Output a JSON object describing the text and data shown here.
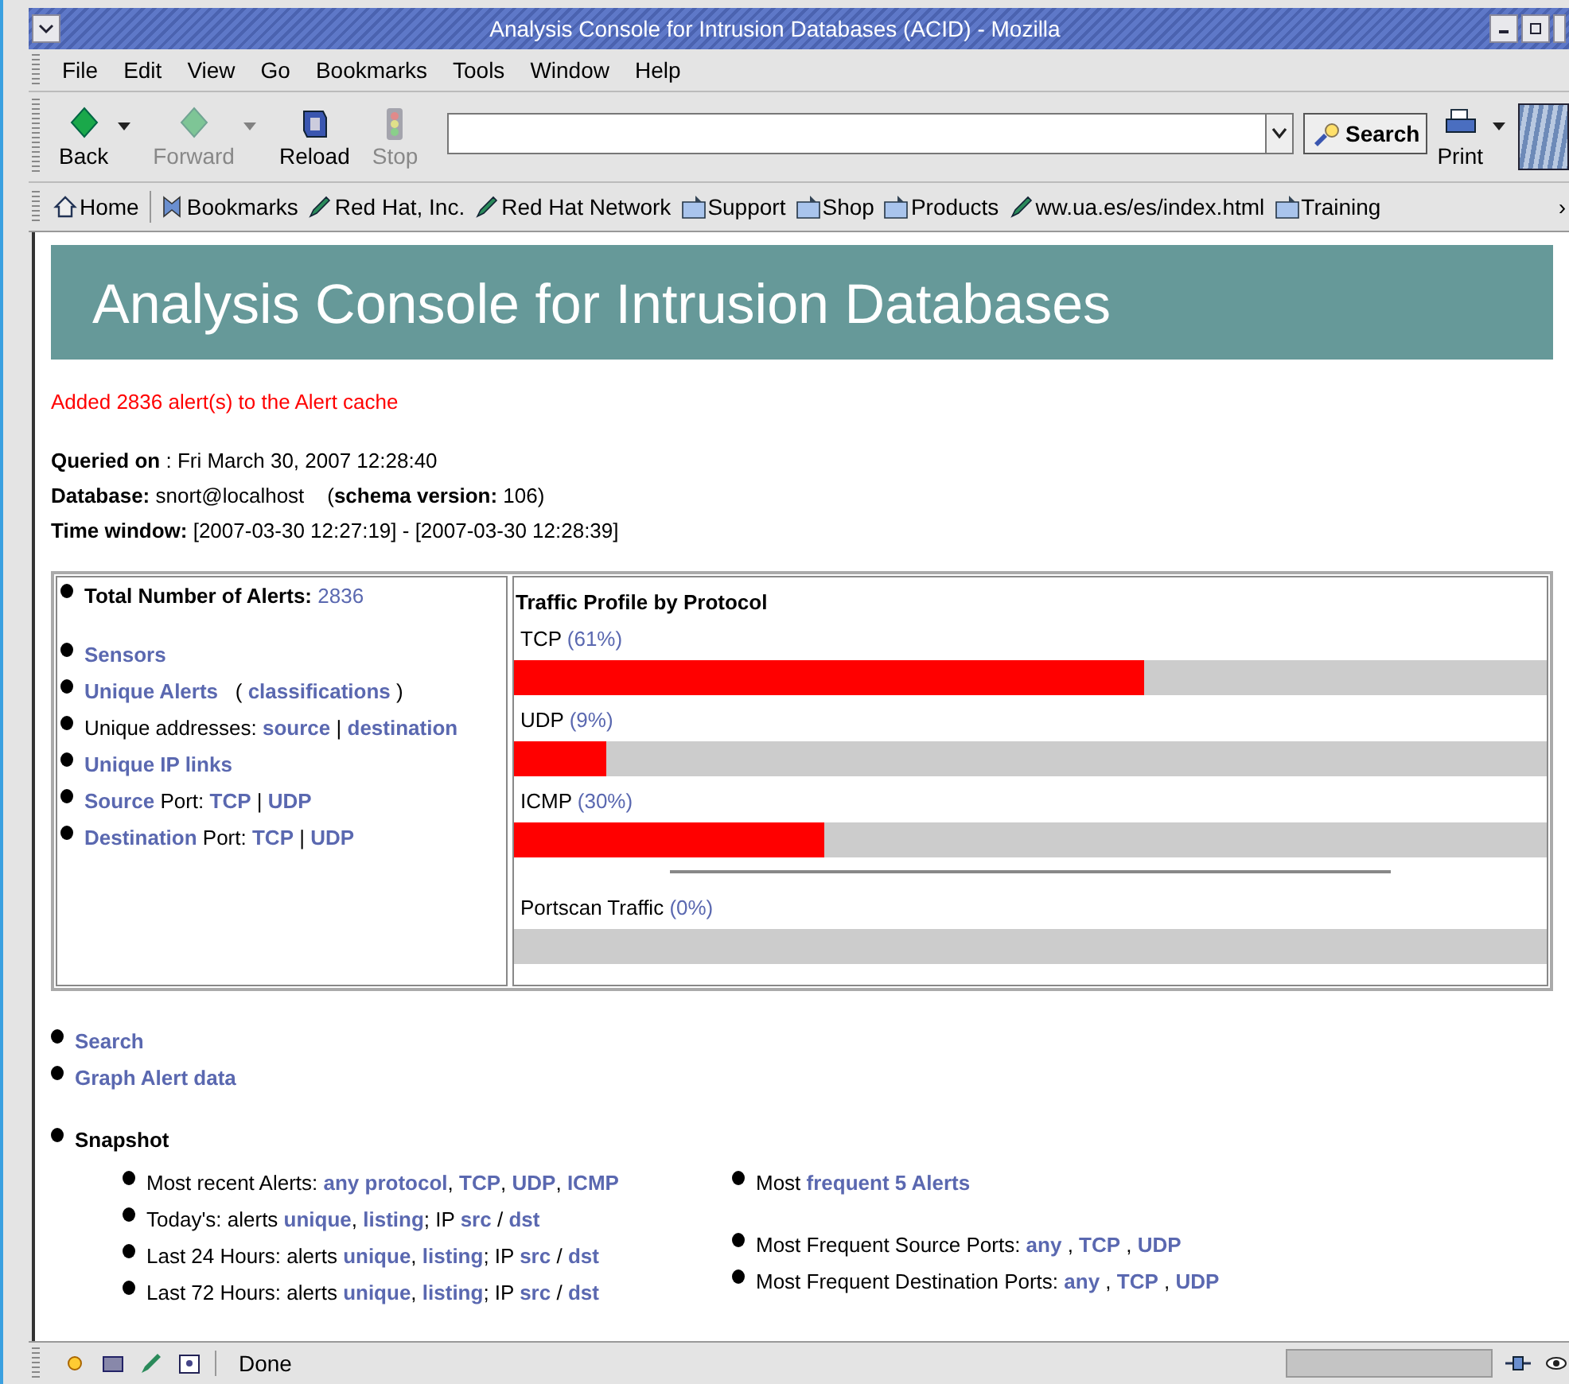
{
  "window": {
    "title": "Analysis Console for Intrusion Databases (ACID) - Mozilla"
  },
  "menu": [
    "File",
    "Edit",
    "View",
    "Go",
    "Bookmarks",
    "Tools",
    "Window",
    "Help"
  ],
  "toolbar": {
    "buttons": [
      {
        "label": "Back",
        "kind": "back",
        "disabled": false,
        "dropdown": true
      },
      {
        "label": "Forward",
        "kind": "forward",
        "disabled": true,
        "dropdown": true
      },
      {
        "label": "Reload",
        "kind": "reload",
        "disabled": false,
        "dropdown": false
      },
      {
        "label": "Stop",
        "kind": "stop",
        "disabled": true,
        "dropdown": false
      }
    ],
    "search_button": "Search",
    "print_button": "Print"
  },
  "bookmarks": [
    {
      "label": "Home",
      "kind": "home"
    },
    {
      "label": "Bookmarks",
      "kind": "bookmarks"
    },
    {
      "label": "Red Hat, Inc.",
      "kind": "link"
    },
    {
      "label": "Red Hat Network",
      "kind": "link"
    },
    {
      "label": "Support",
      "kind": "folder"
    },
    {
      "label": "Shop",
      "kind": "folder"
    },
    {
      "label": "Products",
      "kind": "folder"
    },
    {
      "label": "ww.ua.es/es/index.html",
      "kind": "link"
    },
    {
      "label": "Training",
      "kind": "folder"
    }
  ],
  "bookmarks_overflow": "›",
  "page": {
    "banner": "Analysis Console for Intrusion Databases",
    "notice": "Added 2836 alert(s) to the Alert cache",
    "query_info": [
      [
        {
          "t": "Queried on",
          "kind": "bold"
        },
        {
          "t": " : Fri March 30, 2007 12:28:40",
          "kind": "text"
        }
      ],
      [
        {
          "t": "Database:",
          "kind": "bold"
        },
        {
          "t": " snort@localhost    (",
          "kind": "text"
        },
        {
          "t": "schema version:",
          "kind": "bold"
        },
        {
          "t": " 106)",
          "kind": "text"
        }
      ],
      [
        {
          "t": "Time window:",
          "kind": "bold"
        },
        {
          "t": " [2007-03-30 12:27:19] - [2007-03-30 12:28:39]",
          "kind": "text"
        }
      ]
    ],
    "summary": [
      [
        [
          {
            "t": "Total Number of Alerts: ",
            "kind": "bold"
          },
          {
            "t": "2836",
            "kind": "number"
          }
        ]
      ],
      [
        [
          {
            "t": "Sensors",
            "kind": "link"
          }
        ],
        [
          {
            "t": "Unique Alerts",
            "kind": "link"
          },
          {
            "t": "   ( ",
            "kind": "text"
          },
          {
            "t": "classifications",
            "kind": "link"
          },
          {
            "t": " )",
            "kind": "text"
          }
        ],
        [
          {
            "t": "Unique addresses: ",
            "kind": "text"
          },
          {
            "t": "source",
            "kind": "link"
          },
          {
            "t": " | ",
            "kind": "text"
          },
          {
            "t": "destination",
            "kind": "link"
          }
        ],
        [
          {
            "t": "Unique IP links",
            "kind": "link"
          }
        ],
        [
          {
            "t": "Source",
            "kind": "link"
          },
          {
            "t": " Port: ",
            "kind": "text"
          },
          {
            "t": "TCP",
            "kind": "link"
          },
          {
            "t": " | ",
            "kind": "text"
          },
          {
            "t": "UDP",
            "kind": "link"
          }
        ],
        [
          {
            "t": "Destination",
            "kind": "link"
          },
          {
            "t": " Port: ",
            "kind": "text"
          },
          {
            "t": "TCP",
            "kind": "link"
          },
          {
            "t": " | ",
            "kind": "text"
          },
          {
            "t": "UDP",
            "kind": "link"
          }
        ]
      ]
    ],
    "traffic": {
      "title": "Traffic Profile by Protocol",
      "protocols": [
        {
          "name": "TCP",
          "percent": "(61%)",
          "level": 0.61
        },
        {
          "name": "UDP",
          "percent": "(9%)",
          "level": 0.09
        },
        {
          "name": "ICMP",
          "percent": "(30%)",
          "level": 0.3
        }
      ],
      "portscan": {
        "name": "Portscan Traffic",
        "percent": "(0%)",
        "level": 0
      }
    },
    "links": [
      [
        {
          "t": "Search",
          "kind": "link"
        }
      ],
      [
        {
          "t": "Graph Alert data",
          "kind": "link"
        }
      ]
    ],
    "snapshot": {
      "title": "Snapshot",
      "left": [
        [
          {
            "t": "Most recent Alerts: ",
            "kind": "text"
          },
          {
            "t": "any protocol",
            "kind": "link"
          },
          {
            "t": ", ",
            "kind": "text"
          },
          {
            "t": "TCP",
            "kind": "link"
          },
          {
            "t": ", ",
            "kind": "text"
          },
          {
            "t": "UDP",
            "kind": "link"
          },
          {
            "t": ", ",
            "kind": "text"
          },
          {
            "t": "ICMP",
            "kind": "link"
          }
        ],
        [
          {
            "t": "Today's: alerts ",
            "kind": "text"
          },
          {
            "t": "unique",
            "kind": "link"
          },
          {
            "t": ", ",
            "kind": "text"
          },
          {
            "t": "listing",
            "kind": "link"
          },
          {
            "t": "; IP ",
            "kind": "text"
          },
          {
            "t": "src",
            "kind": "link"
          },
          {
            "t": " / ",
            "kind": "text"
          },
          {
            "t": "dst",
            "kind": "link"
          }
        ],
        [
          {
            "t": "Last 24 Hours: alerts ",
            "kind": "text"
          },
          {
            "t": "unique",
            "kind": "link"
          },
          {
            "t": ", ",
            "kind": "text"
          },
          {
            "t": "listing",
            "kind": "link"
          },
          {
            "t": "; IP ",
            "kind": "text"
          },
          {
            "t": "src",
            "kind": "link"
          },
          {
            "t": " / ",
            "kind": "text"
          },
          {
            "t": "dst",
            "kind": "link"
          }
        ],
        [
          {
            "t": "Last 72 Hours: alerts ",
            "kind": "text"
          },
          {
            "t": "unique",
            "kind": "link"
          },
          {
            "t": ", ",
            "kind": "text"
          },
          {
            "t": "listing",
            "kind": "link"
          },
          {
            "t": "; IP ",
            "kind": "text"
          },
          {
            "t": "src",
            "kind": "link"
          },
          {
            "t": " / ",
            "kind": "text"
          },
          {
            "t": "dst",
            "kind": "link"
          }
        ]
      ],
      "right": [
        [
          [
            {
              "t": "Most ",
              "kind": "text"
            },
            {
              "t": "frequent 5 Alerts",
              "kind": "link"
            }
          ]
        ],
        [
          [
            {
              "t": "Most Frequent Source Ports: ",
              "kind": "text"
            },
            {
              "t": "any",
              "kind": "link"
            },
            {
              "t": " , ",
              "kind": "text"
            },
            {
              "t": "TCP",
              "kind": "link"
            },
            {
              "t": " , ",
              "kind": "text"
            },
            {
              "t": "UDP",
              "kind": "link"
            }
          ],
          [
            {
              "t": "Most Frequent Destination Ports: ",
              "kind": "text"
            },
            {
              "t": "any",
              "kind": "link"
            },
            {
              "t": " , ",
              "kind": "text"
            },
            {
              "t": "TCP",
              "kind": "link"
            },
            {
              "t": " , ",
              "kind": "text"
            },
            {
              "t": "UDP",
              "kind": "link"
            }
          ]
        ]
      ]
    }
  },
  "status_bar": {
    "text": "Done"
  }
}
